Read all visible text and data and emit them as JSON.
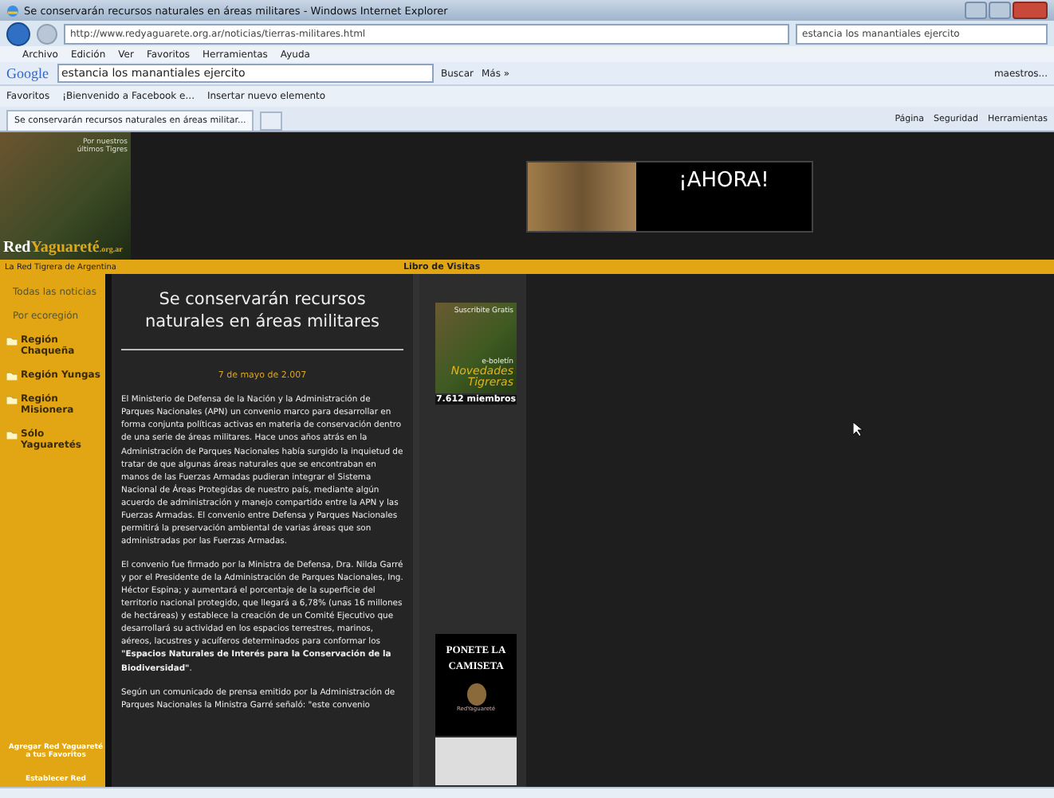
{
  "window": {
    "title": "Se conservarán recursos naturales en áreas militares - Windows Internet Explorer"
  },
  "address_bar": {
    "url": "http://www.redyaguarete.org.ar/noticias/tierras-militares.html",
    "search_value": "estancia los manantiales ejercito"
  },
  "menu": [
    "Archivo",
    "Edición",
    "Ver",
    "Favoritos",
    "Herramientas",
    "Ayuda"
  ],
  "google_toolbar": {
    "logo": "Google",
    "search_value": "estancia los manantiales ejercito",
    "search_button": "Buscar",
    "more": "Más »",
    "account": "maestros..."
  },
  "favorites_bar": {
    "label": "Favoritos",
    "links": [
      "¡Bienvenido a Facebook e...",
      "Insertar nuevo elemento"
    ]
  },
  "tabs": [
    {
      "label": "Se conservarán recursos naturales en áreas militar...",
      "selected": true
    }
  ],
  "command_bar": [
    "Página",
    "Seguridad",
    "Herramientas"
  ],
  "header": {
    "tagline": "Por nuestros últimos Tigres",
    "logo_red": "Red",
    "logo_name": "Yaguareté",
    "logo_domain": ".org.ar",
    "banner": "¡AHORA!"
  },
  "strip": {
    "left": "La Red Tigrera de Argentina",
    "center": "Libro de Visitas"
  },
  "sidebar": {
    "items": [
      {
        "kind": "link",
        "label": "Todas las noticias"
      },
      {
        "kind": "link",
        "label": "Por ecoregión"
      },
      {
        "kind": "folder",
        "label": "Región Chaqueña"
      },
      {
        "kind": "folder",
        "label": "Región Yungas"
      },
      {
        "kind": "folder",
        "label": "Región Misionera"
      },
      {
        "kind": "folder",
        "label": "Sólo Yaguaretés"
      }
    ],
    "bottom_links": [
      "Agregar Red Yaguareté a tus Favoritos",
      "Establecer Red"
    ]
  },
  "article": {
    "title": "Se conservarán recursos naturales en áreas militares",
    "date": "7 de mayo de 2.007",
    "paragraphs": [
      "El Ministerio de Defensa de la Nación y la Administración de Parques Nacionales (APN) un convenio marco para desarrollar en forma conjunta políticas activas en materia de conservación dentro de una serie de áreas militares. Hace unos años atrás en la Administración de Parques Nacionales había surgido la inquietud de tratar de que algunas áreas naturales que se encontraban en manos de las Fuerzas Armadas pudieran integrar el Sistema Nacional de Áreas Protegidas de nuestro país, mediante algún acuerdo de administración y manejo compartido entre la APN y las Fuerzas Armadas. El convenio entre Defensa y Parques Nacionales permitirá la preservación ambiental de varias áreas que son administradas por las Fuerzas Armadas.",
      "El convenio fue firmado por la Ministra de Defensa, Dra. Nilda Garré y por el Presidente de la Administración de Parques Nacionales, Ing. Héctor Espina; y aumentará el porcentaje de la superficie del territorio nacional protegido, que llegará a 6,78% (unas 16 millones de hectáreas) y establece la creación de un Comité Ejecutivo que desarrollará su actividad en los espacios terrestres, marinos, aéreos, lacustres y acuíferos determinados para conformar los **\"Espacios Naturales de Interés para la Conservación de la Biodiversidad\"**.",
      "Según un comunicado de prensa emitido por la Administración de Parques Nacionales la Ministra Garré señaló: \"este convenio"
    ]
  },
  "promo": {
    "newsletter_top": "Suscribite Gratis",
    "newsletter_mid": "e-boletín",
    "newsletter_title": "Novedades Tigreras",
    "members": "7.612 miembros",
    "shirt_title": "PONETE LA CAMISETA",
    "shirt_logo": "RedYaguareté"
  }
}
